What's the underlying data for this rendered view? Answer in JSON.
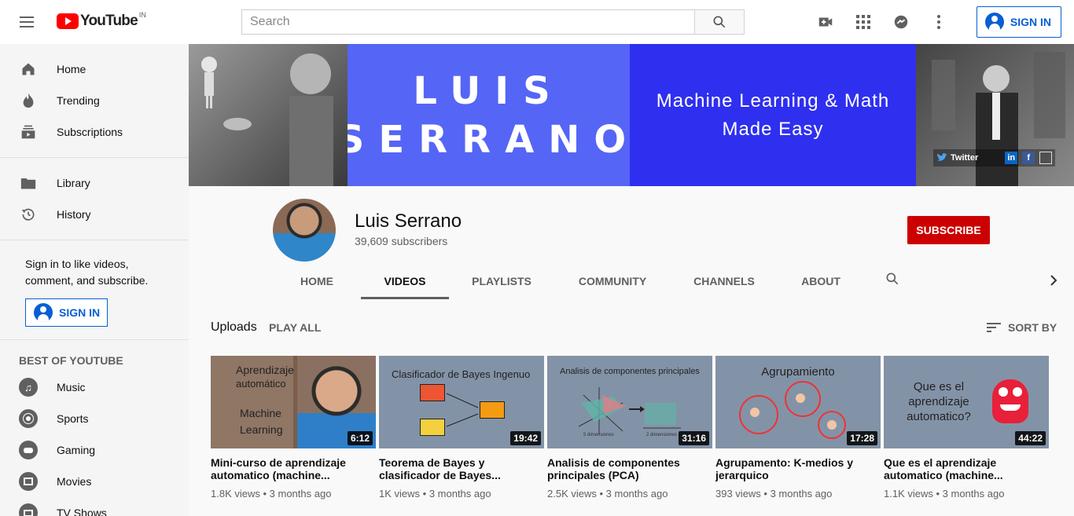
{
  "topbar": {
    "logo_text": "YouTube",
    "country": "IN",
    "search_placeholder": "Search",
    "signin_label": "SIGN IN"
  },
  "sidebar": {
    "main_items": [
      {
        "label": "Home",
        "icon": "home-icon"
      },
      {
        "label": "Trending",
        "icon": "trending-icon"
      },
      {
        "label": "Subscriptions",
        "icon": "subscriptions-icon"
      }
    ],
    "library_items": [
      {
        "label": "Library",
        "icon": "folder-icon"
      },
      {
        "label": "History",
        "icon": "history-icon"
      }
    ],
    "signin_prompt": "Sign in to like videos, comment, and subscribe.",
    "signin_label": "SIGN IN",
    "section_title": "BEST OF YOUTUBE",
    "best_items": [
      {
        "label": "Music",
        "icon": "music-icon"
      },
      {
        "label": "Sports",
        "icon": "sports-icon"
      },
      {
        "label": "Gaming",
        "icon": "gaming-icon"
      },
      {
        "label": "Movies",
        "icon": "movies-icon"
      },
      {
        "label": "TV Shows",
        "icon": "tv-icon"
      }
    ]
  },
  "banner": {
    "name_line1": "LUIS",
    "name_line2": "SERRANO",
    "tagline_line1": "Machine Learning & Math",
    "tagline_line2": "Made Easy",
    "twitter_label": "Twitter",
    "linkedin_label": "in",
    "facebook_label": "f",
    "colors": {
      "name_bg": "#5565f6",
      "tag_bg": "#2f2ff0"
    }
  },
  "channel": {
    "name": "Luis Serrano",
    "subscribers": "39,609 subscribers",
    "subscribe_label": "SUBSCRIBE",
    "tabs": [
      "HOME",
      "VIDEOS",
      "PLAYLISTS",
      "COMMUNITY",
      "CHANNELS",
      "ABOUT"
    ],
    "active_tab": "VIDEOS"
  },
  "uploads": {
    "title": "Uploads",
    "play_all": "PLAY ALL",
    "sort_by": "SORT BY",
    "videos": [
      {
        "duration": "6:12",
        "title": "Mini-curso de aprendizaje automatico (machine...",
        "views": "1.8K views",
        "age": "3 months ago",
        "thumb_text": [
          "Aprendizaje",
          "automático",
          "Machine",
          "Learning"
        ]
      },
      {
        "duration": "19:42",
        "title": "Teorema de Bayes y clasificador de Bayes...",
        "views": "1K views",
        "age": "3 months ago",
        "thumb_text": [
          "Clasificador de Bayes Ingenuo"
        ]
      },
      {
        "duration": "31:16",
        "title": "Analisis de componentes principales (PCA)",
        "views": "2.5K views",
        "age": "3 months ago",
        "thumb_text": [
          "Analisis de componentes principales",
          "5 dimensiones",
          "2 dimensiones"
        ]
      },
      {
        "duration": "17:28",
        "title": "Agrupamento: K-medios y jerarquico",
        "views": "393 views",
        "age": "3 months ago",
        "thumb_text": [
          "Agrupamiento"
        ]
      },
      {
        "duration": "44:22",
        "title": "Que es el aprendizaje automatico (machine...",
        "views": "1.1K views",
        "age": "3 months ago",
        "thumb_text": [
          "Que es el",
          "aprendizaje",
          "automatico?"
        ]
      }
    ]
  }
}
